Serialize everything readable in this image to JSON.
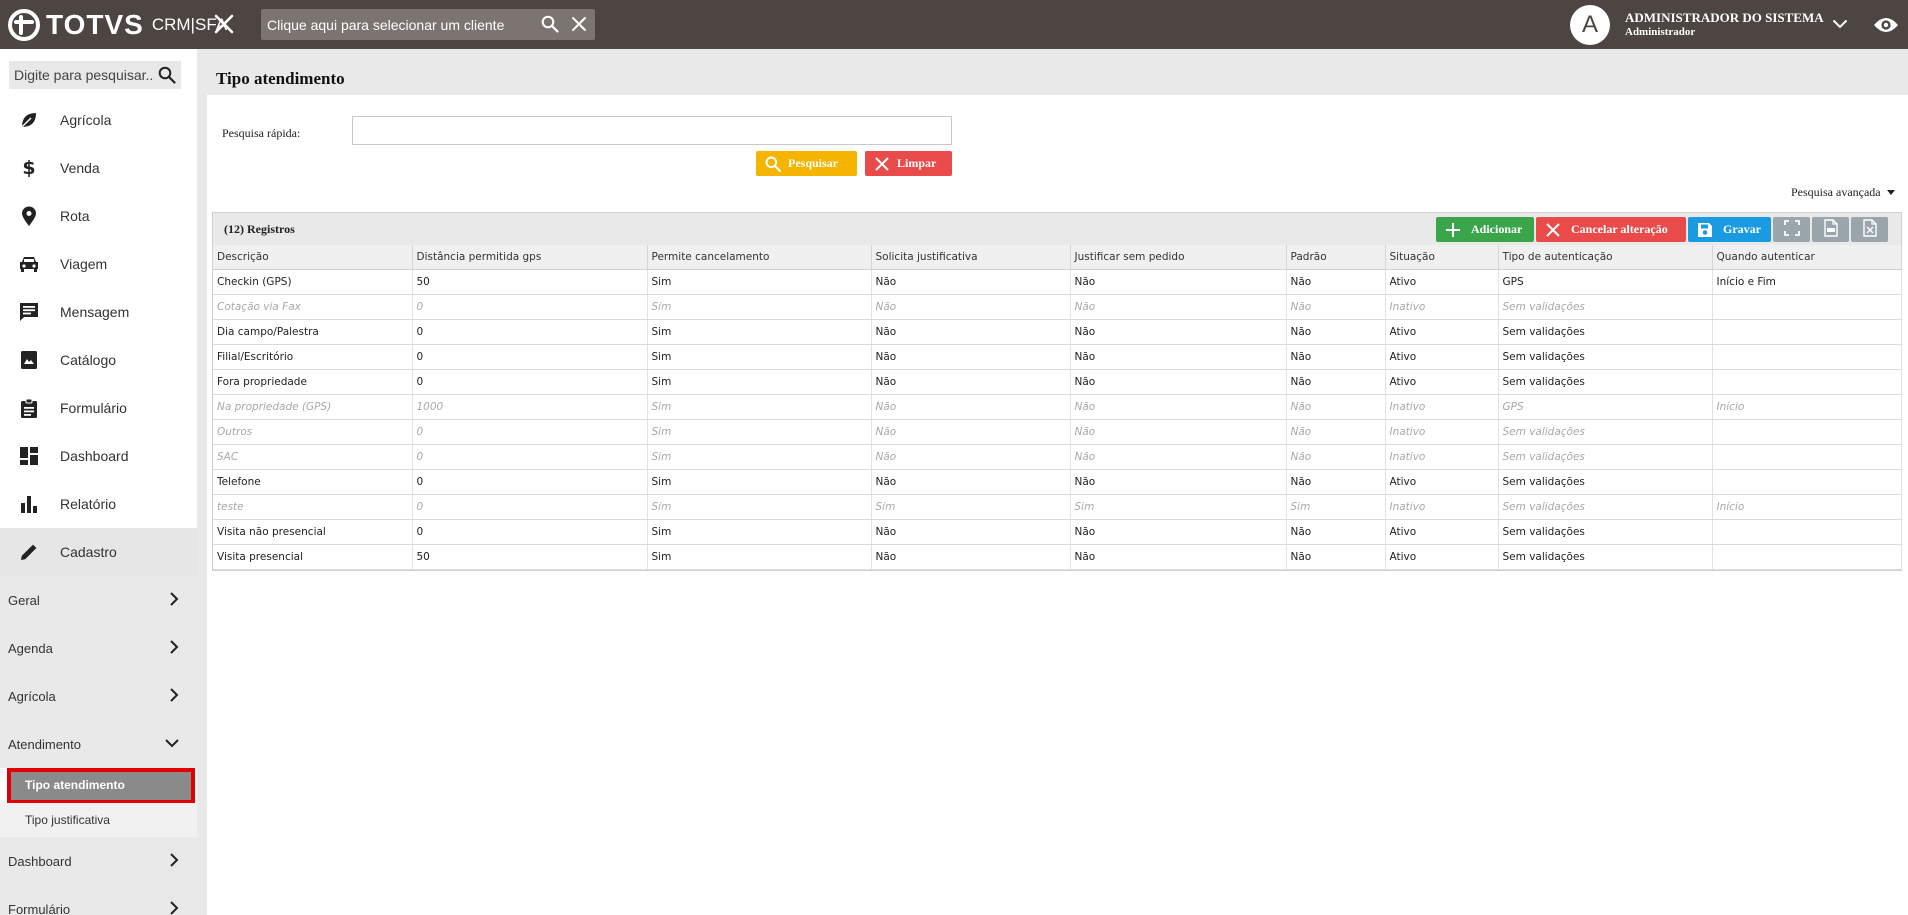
{
  "header": {
    "logo_text": "TOTVS",
    "logo_sub": "CRM|SFA",
    "client_placeholder": "Clique aqui para selecionar um cliente",
    "avatar_letter": "A",
    "user_name": "ADMINISTRADOR DO SISTEMA",
    "user_role": "Administrador"
  },
  "sidebar": {
    "search_placeholder": "Digite para pesquisar...",
    "menu": [
      {
        "label": "Agrícola",
        "icon": "leaf-icon"
      },
      {
        "label": "Venda",
        "icon": "dollar-icon"
      },
      {
        "label": "Rota",
        "icon": "map-pin-icon"
      },
      {
        "label": "Viagem",
        "icon": "car-icon"
      },
      {
        "label": "Mensagem",
        "icon": "chat-icon"
      },
      {
        "label": "Catálogo",
        "icon": "catalog-icon"
      },
      {
        "label": "Formulário",
        "icon": "clipboard-icon"
      },
      {
        "label": "Dashboard",
        "icon": "dashboard-icon"
      },
      {
        "label": "Relatório",
        "icon": "bar-chart-icon"
      },
      {
        "label": "Cadastro",
        "icon": "pencil-icon"
      }
    ],
    "groups": [
      {
        "label": "Geral"
      },
      {
        "label": "Agenda"
      },
      {
        "label": "Agrícola"
      },
      {
        "label": "Atendimento"
      }
    ],
    "leaves": [
      {
        "label": "Tipo atendimento"
      },
      {
        "label": "Tipo justificativa"
      }
    ],
    "groups_after": [
      {
        "label": "Dashboard"
      },
      {
        "label": "Formulário"
      }
    ]
  },
  "main": {
    "title": "Tipo atendimento",
    "quick_search_label": "Pesquisa rápida:",
    "quick_search_value": "",
    "search_button": "Pesquisar",
    "clear_button": "Limpar",
    "advanced_search": "Pesquisa avançada",
    "records_label": "(12) Registros",
    "add_button": "Adicionar",
    "cancel_button": "Cancelar alteração",
    "save_button": "Gravar"
  },
  "table": {
    "columns": [
      "Descrição",
      "Distância permitida gps",
      "Permite cancelamento",
      "Solicita justificativa",
      "Justificar sem pedido",
      "Padrão",
      "Situação",
      "Tipo de autenticação",
      "Quando autenticar"
    ],
    "rows": [
      {
        "inactive": false,
        "cells": [
          "Checkin (GPS)",
          "50",
          "Sim",
          "Não",
          "Não",
          "Não",
          "Ativo",
          "GPS",
          "Início e Fim"
        ]
      },
      {
        "inactive": true,
        "cells": [
          "Cotação via Fax",
          "0",
          "Sim",
          "Não",
          "Não",
          "Não",
          "Inativo",
          "Sem validações",
          ""
        ]
      },
      {
        "inactive": false,
        "cells": [
          "Dia campo/Palestra",
          "0",
          "Sim",
          "Não",
          "Não",
          "Não",
          "Ativo",
          "Sem validações",
          ""
        ]
      },
      {
        "inactive": false,
        "cells": [
          "Filial/Escritório",
          "0",
          "Sim",
          "Não",
          "Não",
          "Não",
          "Ativo",
          "Sem validações",
          ""
        ]
      },
      {
        "inactive": false,
        "cells": [
          "Fora propriedade",
          "0",
          "Sim",
          "Não",
          "Não",
          "Não",
          "Ativo",
          "Sem validações",
          ""
        ]
      },
      {
        "inactive": true,
        "cells": [
          "Na propriedade (GPS)",
          "1000",
          "Sim",
          "Não",
          "Não",
          "Não",
          "Inativo",
          "GPS",
          "Início"
        ]
      },
      {
        "inactive": true,
        "cells": [
          "Outros",
          "0",
          "Sim",
          "Não",
          "Não",
          "Não",
          "Inativo",
          "Sem validações",
          ""
        ]
      },
      {
        "inactive": true,
        "cells": [
          "SAC",
          "0",
          "Sim",
          "Não",
          "Não",
          "Não",
          "Inativo",
          "Sem validações",
          ""
        ]
      },
      {
        "inactive": false,
        "cells": [
          "Telefone",
          "0",
          "Sim",
          "Não",
          "Não",
          "Não",
          "Ativo",
          "Sem validações",
          ""
        ]
      },
      {
        "inactive": true,
        "cells": [
          "teste",
          "0",
          "Sim",
          "Sim",
          "Sim",
          "Sim",
          "Inativo",
          "Sem validações",
          "Início"
        ]
      },
      {
        "inactive": false,
        "cells": [
          "Visita não presencial",
          "0",
          "Sim",
          "Não",
          "Não",
          "Não",
          "Ativo",
          "Sem validações",
          ""
        ]
      },
      {
        "inactive": false,
        "cells": [
          "Visita presencial",
          "50",
          "Sim",
          "Não",
          "Não",
          "Não",
          "Ativo",
          "Sem validações",
          ""
        ]
      }
    ]
  },
  "colors": {
    "topbar": "#4c4541",
    "search_btn": "#f4b400",
    "clear_btn": "#e94b4b",
    "add_btn": "#3aa54a",
    "save_btn": "#1a9ae0",
    "highlight": "#e40000"
  }
}
